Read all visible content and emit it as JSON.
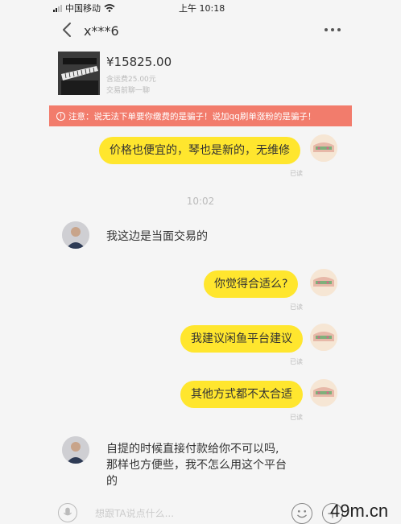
{
  "status_bar": {
    "carrier": "中国移动",
    "time": "上午 10:18"
  },
  "header": {
    "title": "x***6"
  },
  "product": {
    "price": "¥15825.00",
    "shipping": "含运费25.00元",
    "stage": "交易前聊一聊"
  },
  "warning": {
    "text": "注意：说无法下单要你缴费的是骗子！说加qq刷单涨粉的是骗子！"
  },
  "messages": [
    {
      "sender": "me",
      "text": "价格也便宜的，琴也是新的，无维修",
      "status": "已读"
    },
    {
      "sender": "me",
      "text": "你觉得合适么?",
      "status": "已读"
    },
    {
      "sender": "me",
      "text": "我建议闲鱼平台建议",
      "status": "已读"
    },
    {
      "sender": "me",
      "text": "其他方式都不太合适",
      "status": "已读"
    }
  ],
  "other_messages": [
    {
      "sender": "other",
      "text": "我这边是当面交易的"
    },
    {
      "sender": "other",
      "lines": [
        "自提的时候直接付款给你不可以吗,",
        "那样也方便些，我不怎么用这个平台",
        "的"
      ]
    }
  ],
  "time_separator": "10:02",
  "input": {
    "placeholder": "想跟TA说点什么..."
  },
  "watermark": "49m.cn"
}
